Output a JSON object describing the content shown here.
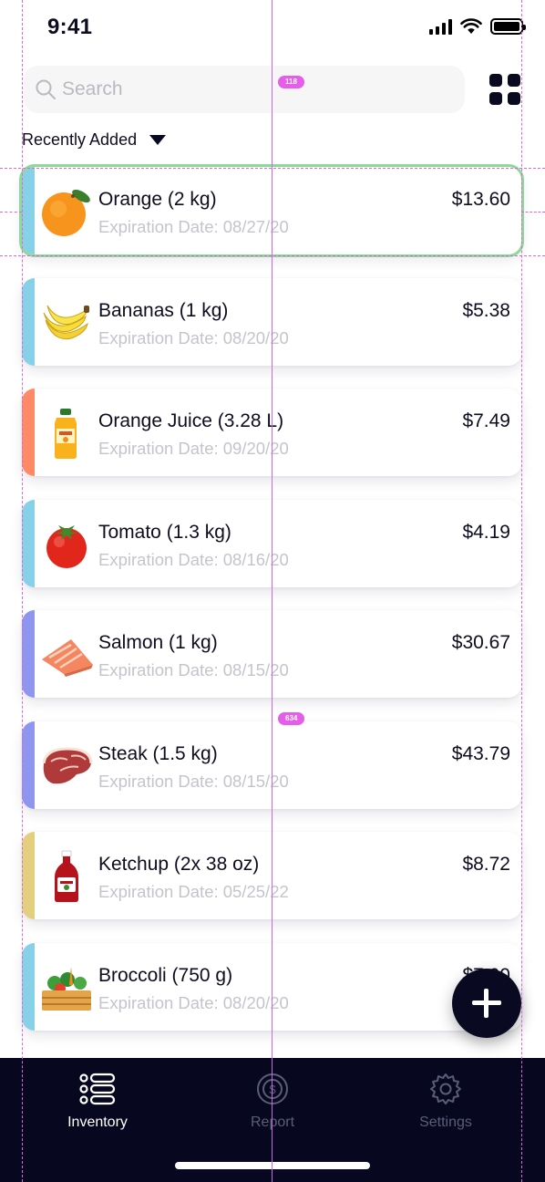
{
  "status_bar": {
    "time": "9:41"
  },
  "search": {
    "placeholder": "Search"
  },
  "sort": {
    "label": "Recently Added"
  },
  "items": [
    {
      "name": "Orange (2 kg)",
      "expiration": "Expiration Date: 08/27/20",
      "price": "$13.60",
      "accent": "#86d0e8",
      "icon": "orange-icon"
    },
    {
      "name": "Bananas (1 kg)",
      "expiration": "Expiration Date: 08/20/20",
      "price": "$5.38",
      "accent": "#86d0e8",
      "icon": "banana-icon"
    },
    {
      "name": "Orange Juice (3.28 L)",
      "expiration": "Expiration Date: 09/20/20",
      "price": "$7.49",
      "accent": "#ff8a65",
      "icon": "juice-bottle-icon"
    },
    {
      "name": "Tomato (1.3 kg)",
      "expiration": "Expiration Date: 08/16/20",
      "price": "$4.19",
      "accent": "#86d0e8",
      "icon": "tomato-icon"
    },
    {
      "name": "Salmon (1 kg)",
      "expiration": "Expiration Date: 08/15/20",
      "price": "$30.67",
      "accent": "#8f96f0",
      "icon": "salmon-icon"
    },
    {
      "name": "Steak (1.5 kg)",
      "expiration": "Expiration Date: 08/15/20",
      "price": "$43.79",
      "accent": "#8f96f0",
      "icon": "steak-icon"
    },
    {
      "name": "Ketchup (2x 38 oz)",
      "expiration": "Expiration Date: 05/25/22",
      "price": "$8.72",
      "accent": "#e4cf7e",
      "icon": "ketchup-icon"
    },
    {
      "name": "Broccoli (750 g)",
      "expiration": "Expiration Date: 08/20/20",
      "price": "$7.90",
      "accent": "#86d0e8",
      "icon": "vegetable-crate-icon"
    }
  ],
  "tabs": [
    {
      "label": "Inventory",
      "icon": "list-icon",
      "active": true
    },
    {
      "label": "Report",
      "icon": "dollar-coin-icon",
      "active": false
    },
    {
      "label": "Settings",
      "icon": "gear-icon",
      "active": false
    }
  ],
  "overlay": {
    "badge_top": "118",
    "badge_middle": "634"
  },
  "colors": {
    "tab_bar": "#070820",
    "fab": "#090a22",
    "selection_outline": "#8ed898",
    "guides": "#d66bd6"
  }
}
